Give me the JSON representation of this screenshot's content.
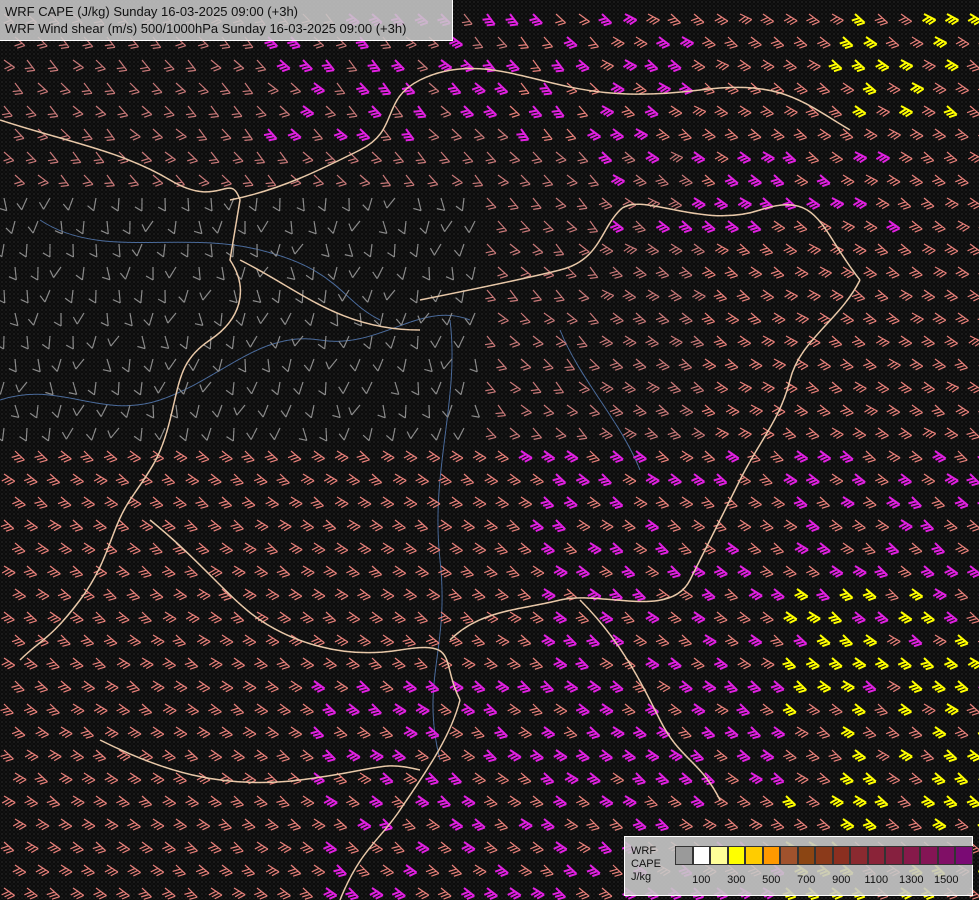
{
  "header": {
    "title_line1": "WRF CAPE (J/kg) Sunday 16-03-2025 09:00 (+3h)",
    "title_line2": "WRF Wind shear (m/s) 500/1000hPa Sunday 16-03-2025 09:00 (+3h)"
  },
  "legend": {
    "title_lines": [
      "WRF",
      "CAPE",
      "J/kg"
    ],
    "colors": [
      "#9a9a9a",
      "#ffffff",
      "#ffff99",
      "#ffff00",
      "#ffcc00",
      "#ff9900",
      "#a0522d",
      "#8b4513",
      "#8b3a1a",
      "#8b2f20",
      "#8a2a30",
      "#8a2338",
      "#86203f",
      "#861a4a",
      "#841555",
      "#800f66",
      "#7a0a74"
    ],
    "ticks": [
      "100",
      "300",
      "500",
      "700",
      "900",
      "1100",
      "1300",
      "1500"
    ]
  },
  "map": {
    "colors": {
      "background": "#0c0c0c",
      "border": "#e8c8a8",
      "river": "#4a6a9a",
      "barb_low": "#8a8a8a",
      "barb_mid": "#c87878",
      "barb_high": "#e8807a",
      "barb_magenta": "#e020e0",
      "barb_yellow": "#ffff00"
    }
  }
}
